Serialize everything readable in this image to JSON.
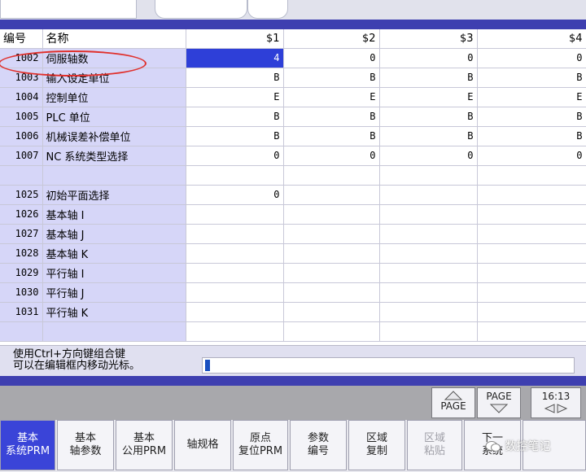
{
  "columns": {
    "no": "编号",
    "name": "名称",
    "p1": "$1",
    "p2": "$2",
    "p3": "$3",
    "p4": "$4"
  },
  "rows": [
    {
      "no": "1002",
      "name": "伺服轴数",
      "v": [
        "4",
        "0",
        "0",
        "0"
      ]
    },
    {
      "no": "1003",
      "name": "输入设定单位",
      "v": [
        "B",
        "B",
        "B",
        "B"
      ]
    },
    {
      "no": "1004",
      "name": "控制单位",
      "v": [
        "E",
        "E",
        "E",
        "E"
      ]
    },
    {
      "no": "1005",
      "name": "PLC 单位",
      "v": [
        "B",
        "B",
        "B",
        "B"
      ]
    },
    {
      "no": "1006",
      "name": "机械误差补偿单位",
      "v": [
        "B",
        "B",
        "B",
        "B"
      ]
    },
    {
      "no": "1007",
      "name": "NC 系统类型选择",
      "v": [
        "0",
        "0",
        "0",
        "0"
      ]
    },
    {
      "no": "",
      "name": "",
      "v": [
        "",
        "",
        "",
        ""
      ]
    },
    {
      "no": "1025",
      "name": "初始平面选择",
      "v": [
        "0",
        "",
        "",
        ""
      ]
    },
    {
      "no": "1026",
      "name": "基本轴 I",
      "v": [
        "",
        "",
        "",
        ""
      ]
    },
    {
      "no": "1027",
      "name": "基本轴 J",
      "v": [
        "",
        "",
        "",
        ""
      ]
    },
    {
      "no": "1028",
      "name": "基本轴 K",
      "v": [
        "",
        "",
        "",
        ""
      ]
    },
    {
      "no": "1029",
      "name": "平行轴 I",
      "v": [
        "",
        "",
        "",
        ""
      ]
    },
    {
      "no": "1030",
      "name": "平行轴 J",
      "v": [
        "",
        "",
        "",
        ""
      ]
    },
    {
      "no": "1031",
      "name": "平行轴 K",
      "v": [
        "",
        "",
        "",
        ""
      ]
    },
    {
      "no": "",
      "name": "",
      "v": [
        "",
        "",
        "",
        ""
      ]
    }
  ],
  "hint": {
    "line1": "使用Ctrl+方向键组合键",
    "line2": "可以在编辑框内移动光标。"
  },
  "page_buttons": {
    "page_up": "PAGE",
    "page_down": "PAGE",
    "clock": "16:13"
  },
  "softkeys": [
    {
      "l1": "基本",
      "l2": "系统PRM"
    },
    {
      "l1": "基本",
      "l2": "轴参数"
    },
    {
      "l1": "基本",
      "l2": "公用PRM"
    },
    {
      "l1": "轴规格",
      "l2": ""
    },
    {
      "l1": "原点",
      "l2": "复位PRM"
    },
    {
      "l1": "参数",
      "l2": "编号"
    },
    {
      "l1": "区域",
      "l2": "复制"
    },
    {
      "l1": "区域",
      "l2": "粘贴"
    },
    {
      "l1": "下一",
      "l2": "系统"
    }
  ],
  "watermark": "数控笔记",
  "colors": {
    "selected": "#2e3fd8",
    "header_band": "#3e3fb0",
    "name_column": "#d6d6f8",
    "annotation": "#e0302c"
  }
}
